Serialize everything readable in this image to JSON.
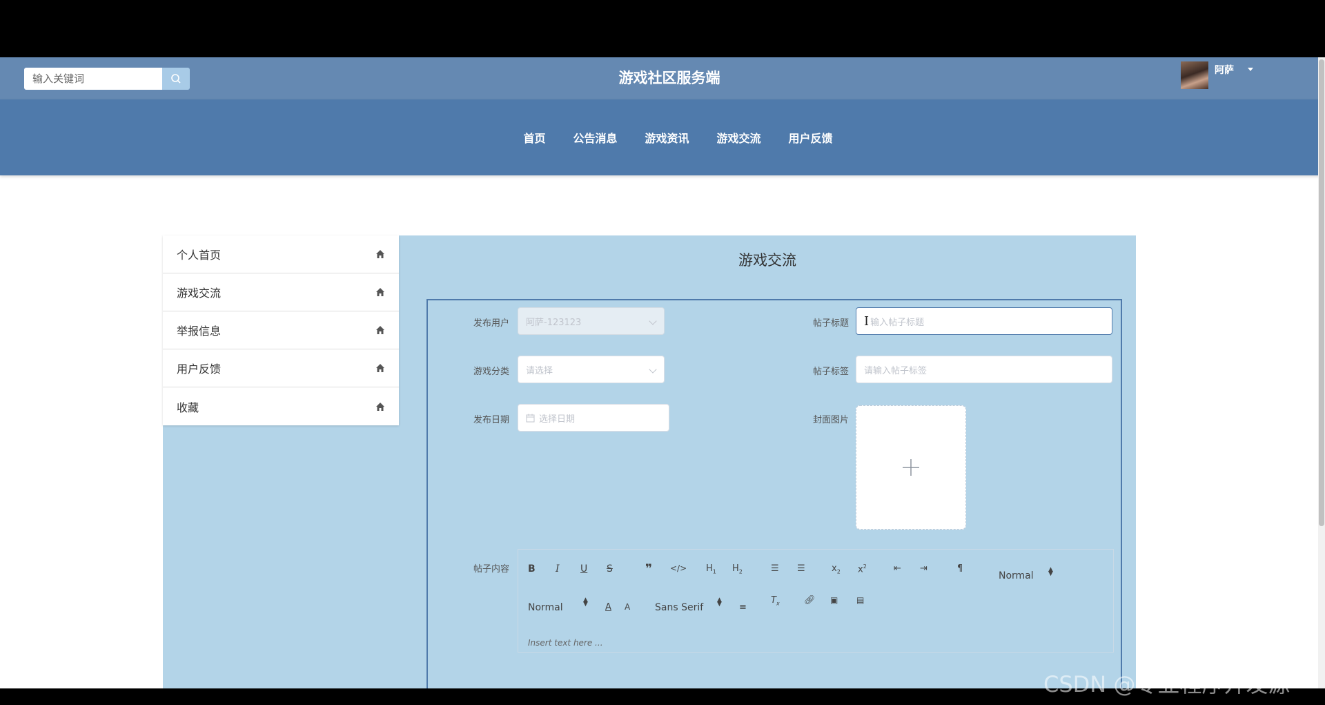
{
  "header": {
    "search_placeholder": "输入关键词",
    "title": "游戏社区服务端",
    "username": "阿萨"
  },
  "nav": {
    "items": [
      "首页",
      "公告消息",
      "游戏资讯",
      "游戏交流",
      "用户反馈"
    ]
  },
  "sidebar": {
    "items": [
      {
        "label": "个人首页",
        "icon": "home-icon"
      },
      {
        "label": "游戏交流",
        "icon": "home-icon"
      },
      {
        "label": "举报信息",
        "icon": "home-icon"
      },
      {
        "label": "用户反馈",
        "icon": "home-icon"
      },
      {
        "label": "收藏",
        "icon": "home-icon"
      }
    ]
  },
  "page": {
    "heading": "游戏交流"
  },
  "form": {
    "publisher_label": "发布用户",
    "publisher_value": "阿萨-123123",
    "title_label": "帖子标题",
    "title_placeholder": "输入帖子标题",
    "category_label": "游戏分类",
    "category_placeholder": "请选择",
    "tags_label": "帖子标签",
    "tags_placeholder": "请输入帖子标签",
    "date_label": "发布日期",
    "date_placeholder": "选择日期",
    "cover_label": "封面图片",
    "content_label": "帖子内容"
  },
  "editor": {
    "header_select": "Normal",
    "size_select": "Normal",
    "font_select": "Sans Serif",
    "placeholder": "Insert text here ..."
  },
  "watermark": "CSDN @专业程序开发源",
  "colors": {
    "header_bg": "#6589b2",
    "nav_bg": "#4f7aab",
    "content_bg": "#b3d4e8"
  }
}
